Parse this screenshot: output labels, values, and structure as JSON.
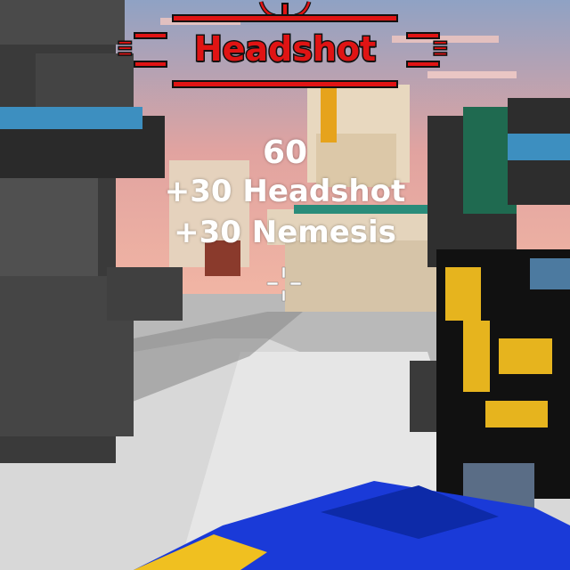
{
  "hud": {
    "banner_title": "Headshot",
    "score_total": "60",
    "score_lines": [
      "+30 Headshot",
      "+30 Nemesis"
    ]
  },
  "colors": {
    "banner_red": "#e01414",
    "banner_outline": "#111111",
    "score_text": "#ffffff",
    "crosshair": "#ffffff"
  },
  "icons": {
    "crosshair": "crosshair-icon",
    "banner_emblem": "headshot-emblem-icon"
  }
}
